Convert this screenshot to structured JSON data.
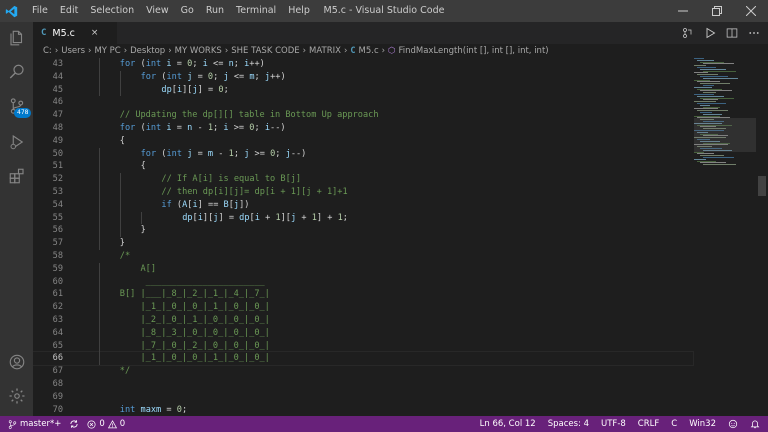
{
  "window": {
    "title": "M5.c - Visual Studio Code",
    "menu": [
      "File",
      "Edit",
      "Selection",
      "View",
      "Go",
      "Run",
      "Terminal",
      "Help"
    ]
  },
  "activity_bar": {
    "icons": [
      "files-icon",
      "search-icon",
      "source-control-icon",
      "run-debug-icon",
      "extensions-icon",
      "account-icon",
      "settings-gear-icon"
    ],
    "scm_badge": "478"
  },
  "tab": {
    "icon_letter": "C",
    "label": "M5.c",
    "close": "×"
  },
  "breadcrumb": {
    "segments": [
      "C:",
      "Users",
      "MY PC",
      "Desktop",
      "MY WORKS",
      "SHE TASK CODE",
      "MATRIX"
    ],
    "file_icon": "C",
    "file": "M5.c",
    "function": "FindMaxLength(int [], int [], int, int)"
  },
  "editor": {
    "lines": [
      {
        "n": "43",
        "indent": 1,
        "tokens": [
          [
            "kw",
            "for"
          ],
          [
            "p",
            " ("
          ],
          [
            "kw",
            "int"
          ],
          [
            "p",
            " "
          ],
          [
            "var",
            "i"
          ],
          [
            "p",
            " = "
          ],
          [
            "num",
            "0"
          ],
          [
            "p",
            "; "
          ],
          [
            "var",
            "i"
          ],
          [
            "p",
            " <= "
          ],
          [
            "var",
            "n"
          ],
          [
            "p",
            "; "
          ],
          [
            "var",
            "i"
          ],
          [
            "p",
            "++)"
          ]
        ]
      },
      {
        "n": "44",
        "indent": 2,
        "tokens": [
          [
            "kw",
            "for"
          ],
          [
            "p",
            " ("
          ],
          [
            "kw",
            "int"
          ],
          [
            "p",
            " "
          ],
          [
            "var",
            "j"
          ],
          [
            "p",
            " = "
          ],
          [
            "num",
            "0"
          ],
          [
            "p",
            "; "
          ],
          [
            "var",
            "j"
          ],
          [
            "p",
            " <= "
          ],
          [
            "var",
            "m"
          ],
          [
            "p",
            "; "
          ],
          [
            "var",
            "j"
          ],
          [
            "p",
            "++)"
          ]
        ]
      },
      {
        "n": "45",
        "indent": 3,
        "tokens": [
          [
            "var",
            "dp"
          ],
          [
            "p",
            "["
          ],
          [
            "var",
            "i"
          ],
          [
            "p",
            "]["
          ],
          [
            "var",
            "j"
          ],
          [
            "p",
            "] = "
          ],
          [
            "num",
            "0"
          ],
          [
            "p",
            ";"
          ]
        ]
      },
      {
        "n": "46",
        "indent": 0,
        "tokens": []
      },
      {
        "n": "47",
        "indent": 1,
        "tokens": [
          [
            "cm",
            "// Updating the dp[][] table in Bottom Up approach"
          ]
        ]
      },
      {
        "n": "48",
        "indent": 1,
        "tokens": [
          [
            "kw",
            "for"
          ],
          [
            "p",
            " ("
          ],
          [
            "kw",
            "int"
          ],
          [
            "p",
            " "
          ],
          [
            "var",
            "i"
          ],
          [
            "p",
            " = "
          ],
          [
            "var",
            "n"
          ],
          [
            "p",
            " - "
          ],
          [
            "num",
            "1"
          ],
          [
            "p",
            "; "
          ],
          [
            "var",
            "i"
          ],
          [
            "p",
            " >= "
          ],
          [
            "num",
            "0"
          ],
          [
            "p",
            "; "
          ],
          [
            "var",
            "i"
          ],
          [
            "p",
            "--)"
          ]
        ]
      },
      {
        "n": "49",
        "indent": 1,
        "tokens": [
          [
            "p",
            "{"
          ]
        ]
      },
      {
        "n": "50",
        "indent": 2,
        "tokens": [
          [
            "kw",
            "for"
          ],
          [
            "p",
            " ("
          ],
          [
            "kw",
            "int"
          ],
          [
            "p",
            " "
          ],
          [
            "var",
            "j"
          ],
          [
            "p",
            " = "
          ],
          [
            "var",
            "m"
          ],
          [
            "p",
            " - "
          ],
          [
            "num",
            "1"
          ],
          [
            "p",
            "; "
          ],
          [
            "var",
            "j"
          ],
          [
            "p",
            " >= "
          ],
          [
            "num",
            "0"
          ],
          [
            "p",
            "; "
          ],
          [
            "var",
            "j"
          ],
          [
            "p",
            "--)"
          ]
        ]
      },
      {
        "n": "51",
        "indent": 2,
        "tokens": [
          [
            "p",
            "{"
          ]
        ]
      },
      {
        "n": "52",
        "indent": 3,
        "tokens": [
          [
            "cm",
            "// If A[i] is equal to B[j]"
          ]
        ]
      },
      {
        "n": "53",
        "indent": 3,
        "tokens": [
          [
            "cm",
            "// then dp[i][j]= dp[i + 1][j + 1]+1"
          ]
        ]
      },
      {
        "n": "54",
        "indent": 3,
        "tokens": [
          [
            "kw",
            "if"
          ],
          [
            "p",
            " ("
          ],
          [
            "var",
            "A"
          ],
          [
            "p",
            "["
          ],
          [
            "var",
            "i"
          ],
          [
            "p",
            "] == "
          ],
          [
            "var",
            "B"
          ],
          [
            "p",
            "["
          ],
          [
            "var",
            "j"
          ],
          [
            "p",
            "])"
          ]
        ]
      },
      {
        "n": "55",
        "indent": 4,
        "tokens": [
          [
            "var",
            "dp"
          ],
          [
            "p",
            "["
          ],
          [
            "var",
            "i"
          ],
          [
            "p",
            "]["
          ],
          [
            "var",
            "j"
          ],
          [
            "p",
            "] = "
          ],
          [
            "var",
            "dp"
          ],
          [
            "p",
            "["
          ],
          [
            "var",
            "i"
          ],
          [
            "p",
            " + "
          ],
          [
            "num",
            "1"
          ],
          [
            "p",
            "]["
          ],
          [
            "var",
            "j"
          ],
          [
            "p",
            " + "
          ],
          [
            "num",
            "1"
          ],
          [
            "p",
            "] + "
          ],
          [
            "num",
            "1"
          ],
          [
            "p",
            ";"
          ]
        ]
      },
      {
        "n": "56",
        "indent": 2,
        "tokens": [
          [
            "p",
            "}"
          ]
        ]
      },
      {
        "n": "57",
        "indent": 1,
        "tokens": [
          [
            "p",
            "}"
          ]
        ]
      },
      {
        "n": "58",
        "indent": 1,
        "tokens": [
          [
            "cm",
            "/*"
          ]
        ]
      },
      {
        "n": "59",
        "indent": 1,
        "tokens": [
          [
            "cm",
            "    A[]"
          ]
        ]
      },
      {
        "n": "60",
        "indent": 1,
        "tokens": [
          [
            "cm",
            "     _______________________"
          ]
        ]
      },
      {
        "n": "61",
        "indent": 1,
        "tokens": [
          [
            "cm",
            "B[] |___|_8_|_2_|_1_|_4_|_7_|"
          ]
        ]
      },
      {
        "n": "62",
        "indent": 1,
        "tokens": [
          [
            "cm",
            "    |_1_|_0_|_0_|_1_|_0_|_0_|"
          ]
        ]
      },
      {
        "n": "63",
        "indent": 1,
        "tokens": [
          [
            "cm",
            "    |_2_|_0_|_1_|_0_|_0_|_0_|"
          ]
        ]
      },
      {
        "n": "64",
        "indent": 1,
        "tokens": [
          [
            "cm",
            "    |_8_|_3_|_0_|_0_|_0_|_0_|"
          ]
        ]
      },
      {
        "n": "65",
        "indent": 1,
        "tokens": [
          [
            "cm",
            "    |_7_|_0_|_2_|_0_|_0_|_0_|"
          ]
        ]
      },
      {
        "n": "66",
        "indent": 1,
        "tokens": [
          [
            "cm",
            "    |_1_|_0_|_0_|_1_|_0_|_0_|"
          ]
        ]
      },
      {
        "n": "67",
        "indent": 1,
        "tokens": [
          [
            "cm",
            "*/"
          ]
        ]
      },
      {
        "n": "68",
        "indent": 0,
        "tokens": []
      },
      {
        "n": "69",
        "indent": 0,
        "tokens": []
      },
      {
        "n": "70",
        "indent": 1,
        "tokens": [
          [
            "kw",
            "int"
          ],
          [
            "p",
            " "
          ],
          [
            "var",
            "maxm"
          ],
          [
            "p",
            " = "
          ],
          [
            "num",
            "0"
          ],
          [
            "p",
            ";"
          ]
        ]
      }
    ],
    "current_line": "66"
  },
  "status_bar": {
    "branch": "master*+",
    "errors": "0",
    "warnings": "0",
    "position": "Ln 66, Col 12",
    "spaces": "Spaces: 4",
    "encoding": "UTF-8",
    "eol": "CRLF",
    "language": "C",
    "platform": "Win32"
  },
  "colors": {
    "statusbar": "#68217a",
    "keyword": "#569cd6",
    "variable": "#9cdcfe",
    "number": "#b5cea8",
    "comment": "#6a9955",
    "function": "#dcdcaa"
  }
}
